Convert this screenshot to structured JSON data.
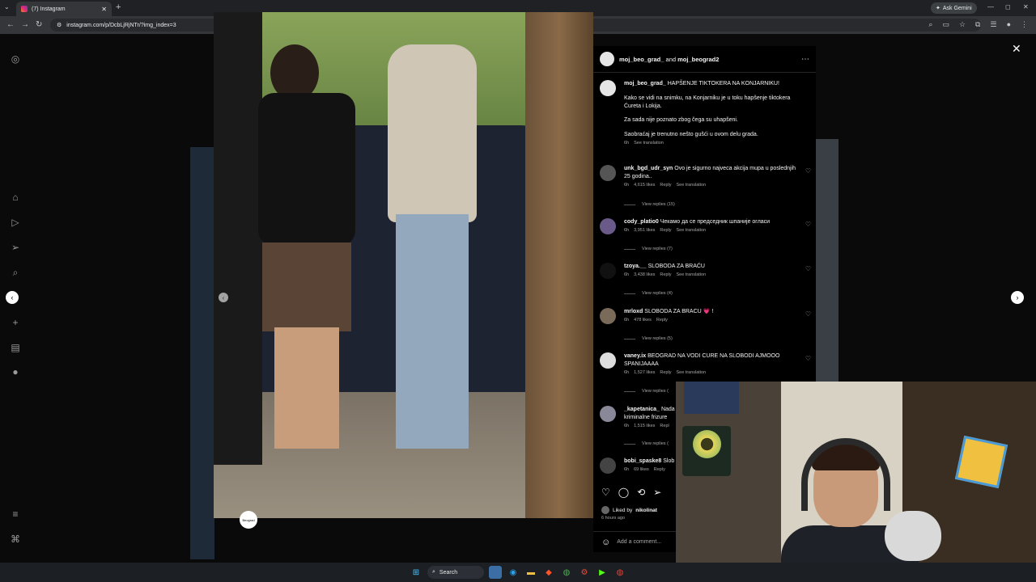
{
  "browser": {
    "tab_title": "(7) Instagram",
    "tab_close": "✕",
    "new_tab": "+",
    "url": "instagram.com/p/DcbLjRjNTr/?img_index=3",
    "ask_gemini": "Ask Gemini"
  },
  "post": {
    "header": {
      "author1": "moj_beo_grad_",
      "and": "and",
      "author2": "moj_beograd2"
    },
    "caption": {
      "author": "moj_beo_grad_",
      "title": "HAPŠENJE TIKTOKERA NA KONJARNIKU!",
      "p1": "Kako se vidi na snimku, na Konjarniku je u toku hapšenje tiktokera Ćureta i Lokija.",
      "p2": "Za sada nije poznato zbog čega su uhapšeni.",
      "p3": "Saobraćaj je trenutno nešto gušći u ovom delu grada.",
      "time": "6h",
      "see_translation": "See translation"
    },
    "photo_badge": "Beograd",
    "comments": [
      {
        "user": "unk_bgd_udr_syn",
        "text": "Ovo je sigurno najveca akcija mupa u poslednjih 25 godina..",
        "time": "6h",
        "likes": "4,615 likes",
        "reply": "Reply",
        "translate": "See translation",
        "view_replies": "View replies (15)"
      },
      {
        "user": "cody_platio0",
        "text": "Чекамо да се председник шпаније огласи",
        "time": "6h",
        "likes": "3,951 likes",
        "reply": "Reply",
        "translate": "See translation",
        "view_replies": "View replies (7)"
      },
      {
        "user": "tzoya.__",
        "text": "SLOBODA ZA BRAĆU",
        "time": "6h",
        "likes": "3,438 likes",
        "reply": "Reply",
        "translate": "See translation",
        "view_replies": "View replies (4)"
      },
      {
        "user": "mrloxd",
        "text": "SLOBODA ZA BRACU 💗 !",
        "time": "6h",
        "likes": "478 likes",
        "reply": "Reply",
        "translate": "",
        "view_replies": "View replies (5)"
      },
      {
        "user": "vaney.ix",
        "text": "BEOGRAD NA VODI CURE NA SLOBODI AJMOOO SPANIJAAAA",
        "time": "6h",
        "likes": "1,527 likes",
        "reply": "Reply",
        "translate": "See translation",
        "view_replies": "View replies ("
      },
      {
        "user": "_kapetanica_",
        "text": "Nada kriminalne frizure",
        "time": "6h",
        "likes": "1,515 likes",
        "reply": "Repl",
        "translate": "",
        "view_replies": "View replies ("
      },
      {
        "user": "bobi_spaske8",
        "text": "Slob",
        "time": "6h",
        "likes": "69 likes",
        "reply": "Reply",
        "translate": "",
        "view_replies": ""
      }
    ],
    "liked_by_prefix": "Liked by",
    "liked_by_user": "nikolinat",
    "posted_time": "6 hours ago",
    "add_comment_placeholder": "Add a comment..."
  },
  "taskbar": {
    "search": "Search"
  }
}
